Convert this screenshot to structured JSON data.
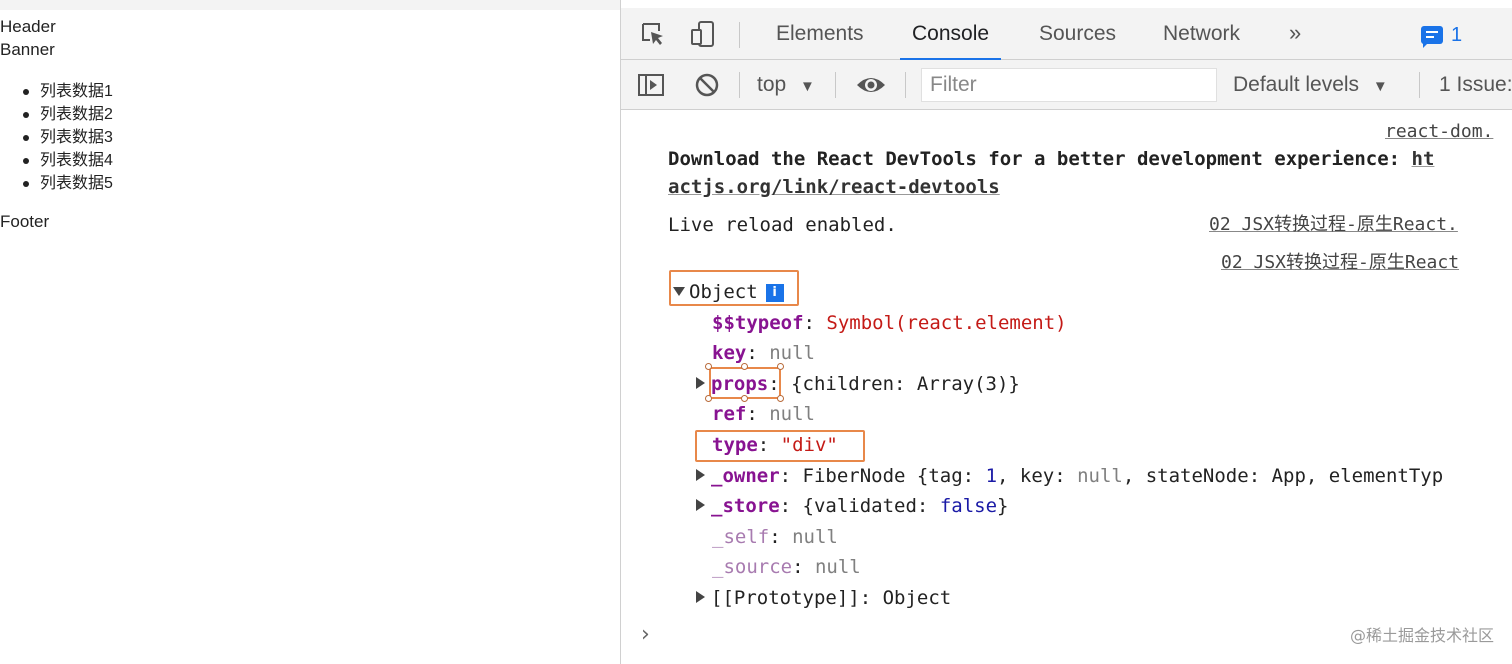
{
  "page": {
    "header_text": "Header",
    "banner_text": "Banner",
    "list_items": [
      "列表数据1",
      "列表数据2",
      "列表数据3",
      "列表数据4",
      "列表数据5"
    ],
    "footer_text": "Footer"
  },
  "devtools": {
    "tabs": [
      {
        "label": "Elements",
        "active": false
      },
      {
        "label": "Console",
        "active": true
      },
      {
        "label": "Sources",
        "active": false
      },
      {
        "label": "Network",
        "active": false
      }
    ],
    "more_tabs_icon": "»",
    "message_count": "1",
    "context": "top",
    "dropdown_arrow": "▼",
    "filter_placeholder": "Filter",
    "levels_label": "Default levels",
    "issues_label": "1 Issue:",
    "accent_color": "#1a73e8"
  },
  "console": {
    "source_1": "react-dom.",
    "devtools_msg_line1": "Download the React DevTools for a better development experience: ",
    "devtools_msg_link_start": "ht",
    "devtools_msg_link_rest": "actjs.org/link/react-devtools",
    "live_reload_msg": "Live reload enabled.",
    "source_2": "02 JSX转换过程-原生React.",
    "source_3": "02 JSX转换过程-原生React",
    "object_label": "Object",
    "info_icon": "i",
    "typeof_key": "$$typeof",
    "typeof_value": "Symbol(react.element)",
    "key_key": "key",
    "key_value": "null",
    "props_key": "props",
    "props_value": "{children: Array(3)}",
    "ref_key": "ref",
    "ref_value": "null",
    "type_key": "type",
    "type_value": "\"div\"",
    "owner_key": "_owner",
    "owner_prefix": "FiberNode {tag: ",
    "owner_tag": "1",
    "owner_mid": ", key: ",
    "owner_keyval": "null",
    "owner_rest": ", stateNode: App, elementTyp",
    "store_key": "_store",
    "store_prefix": "{validated: ",
    "store_value": "false",
    "store_suffix": "}",
    "self_key": "_self",
    "self_value": "null",
    "source_key": "_source",
    "source_value": "null",
    "prototype_label": "[[Prototype]]",
    "prototype_value": "Object",
    "colon": ": ",
    "prompt": "›"
  },
  "watermark": "@稀土掘金技术社区"
}
